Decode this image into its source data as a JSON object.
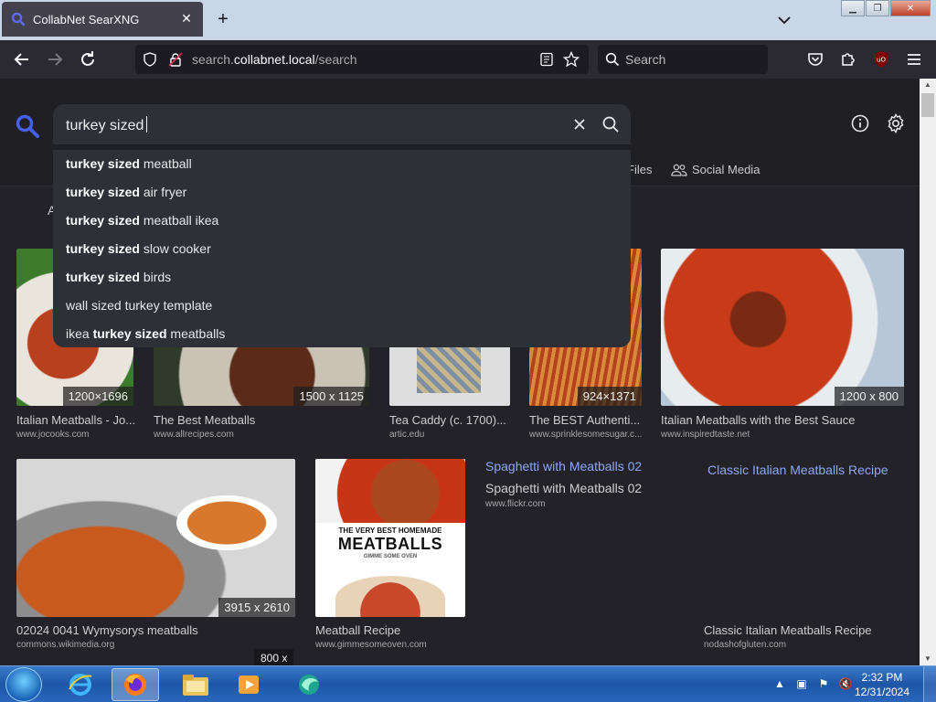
{
  "browser": {
    "tab_title": "CollabNet SearXNG",
    "url_prefix": "search.",
    "url_domain": "collabnet.local",
    "url_path": "/search",
    "search_placeholder": "Search"
  },
  "searx": {
    "query": "turkey sized",
    "partial_label": "A",
    "categories": [
      {
        "label": "Files"
      },
      {
        "label": "Social Media"
      }
    ],
    "suggestions": [
      {
        "bold": "turkey sized",
        "rest": " meatball"
      },
      {
        "bold": "turkey sized",
        "rest": " air fryer"
      },
      {
        "bold": "turkey sized",
        "rest": " meatball ikea"
      },
      {
        "bold": "turkey sized",
        "rest": " slow cooker"
      },
      {
        "bold": "turkey sized",
        "rest": " birds"
      },
      {
        "pre": "wall sized turkey template"
      },
      {
        "pre": "ikea ",
        "bold": "turkey sized",
        "rest": " meatballs"
      }
    ],
    "results": [
      {
        "title": "Italian Meatballs - Jo...",
        "url": "www.jocooks.com",
        "dims": "1200×1696"
      },
      {
        "title": "The Best Meatballs",
        "url": "www.allrecipes.com",
        "dims": "1500 x 1125"
      },
      {
        "title": "Tea Caddy (c. 1700)...",
        "url": "artic.edu"
      },
      {
        "title": "The BEST Authenti...",
        "url": "www.sprinklesomesugar.c...",
        "dims": "924×1371"
      },
      {
        "title": "Italian Meatballs with the Best Sauce",
        "url": "www.inspiredtaste.net",
        "dims": "1200 x 800"
      },
      {
        "title": "02024 0041 Wymysorys meatballs",
        "url": "commons.wikimedia.org",
        "dims": "3915 x 2610"
      },
      {
        "title": "Meatball Recipe",
        "url": "www.gimmesomeoven.com",
        "poster_line1": "THE VERY BEST HOMEMADE",
        "poster_line2": "MEATBALLS",
        "poster_line3": "GIMME SOME OVEN"
      },
      {
        "link_title": "Spaghetti with Meatballs 02",
        "title": "Spaghetti with Meatballs 02",
        "url": "www.flickr.com"
      },
      {
        "link_title": "Classic Italian Meatballs Recipe",
        "title": "Classic Italian Meatballs Recipe",
        "url": "nodashofgluten.com"
      }
    ],
    "floating_dims": "800 x"
  },
  "taskbar": {
    "time": "2:32 PM",
    "date": "12/31/2024"
  },
  "colors": {
    "accent": "#8ea7f5",
    "page_bg": "#222228",
    "suggest_bg": "#2e3038"
  }
}
